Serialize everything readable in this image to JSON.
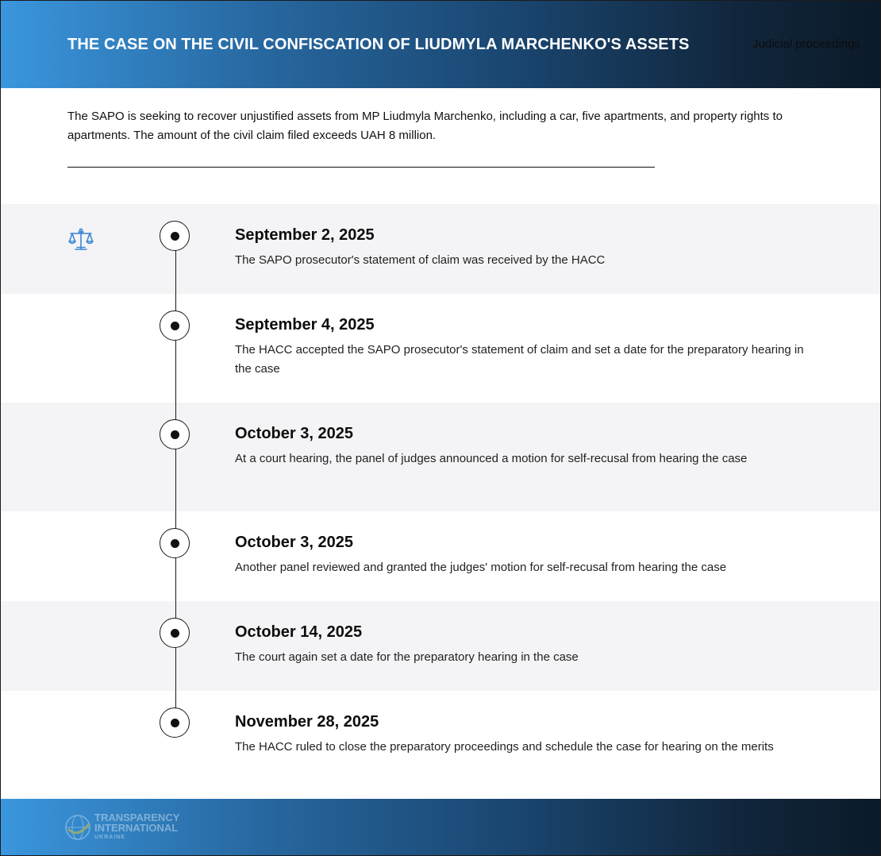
{
  "header": {
    "title": "THE CASE ON THE CIVIL CONFISCATION OF LIUDMYLA MARCHENKO'S ASSETS",
    "tag": "Judicial proceedings"
  },
  "intro": {
    "text": "The SAPO is seeking to recover unjustified assets from MP Liudmyla Marchenko, including a car, five apartments, and property rights to apartments. The amount of the civil claim filed exceeds UAH 8 million."
  },
  "timeline": {
    "icon": "scales-of-justice-icon",
    "events": [
      {
        "date": "September 2, 2025",
        "text": "The SAPO prosecutor's statement of claim was received by the HACC"
      },
      {
        "date": "September 4, 2025",
        "text": "The HACC accepted the SAPO prosecutor's statement of claim and set a date for the preparatory hearing in the case"
      },
      {
        "date": "October 3, 2025",
        "text": "At a court hearing, the panel of judges announced a motion for self-recusal from hearing the case"
      },
      {
        "date": "October 3, 2025",
        "text": "Another panel reviewed and granted the judges' motion for self-recusal from hearing the case"
      },
      {
        "date": "October 14, 2025",
        "text": "The court again set a date for the preparatory hearing in the case"
      },
      {
        "date": "November 28, 2025",
        "text": "The HACC ruled to close the preparatory proceedings and schedule the case for hearing on the merits"
      }
    ]
  },
  "footer": {
    "logo_line1": "TRANSPARENCY",
    "logo_line2": "INTERNATIONAL",
    "logo_line3": "UKRAINE"
  },
  "colors": {
    "accent_blue": "#3a96dd",
    "dark_navy": "#0b1a29",
    "row_shade": "#f4f4f6"
  }
}
